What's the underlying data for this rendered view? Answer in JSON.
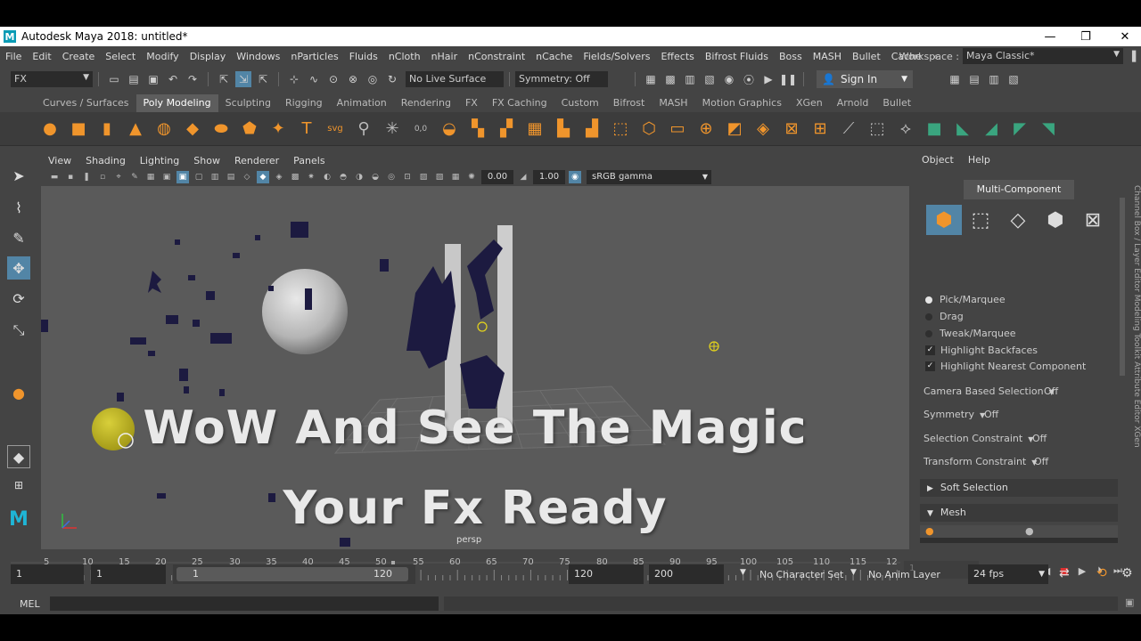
{
  "window": {
    "title": "Autodesk Maya 2018: untitled*",
    "logo": "M",
    "minimize": "—",
    "maximize": "❐",
    "close": "✕"
  },
  "menu": [
    "File",
    "Edit",
    "Create",
    "Select",
    "Modify",
    "Display",
    "Windows",
    "nParticles",
    "Fluids",
    "nCloth",
    "nHair",
    "nConstraint",
    "nCache",
    "Fields/Solvers",
    "Effects",
    "Bifrost Fluids",
    "Boss",
    "MASH",
    "Bullet",
    "Cache"
  ],
  "menu_more": "»",
  "workspace": {
    "label": "Workspace :",
    "value": "Maya Classic*"
  },
  "status": {
    "mode": "FX",
    "live_surface": "No Live Surface",
    "symmetry": "Symmetry: Off",
    "sign_in": "Sign In"
  },
  "shelf_tabs": [
    "Curves / Surfaces",
    "Poly Modeling",
    "Sculpting",
    "Rigging",
    "Animation",
    "Rendering",
    "FX",
    "FX Caching",
    "Custom",
    "Bifrost",
    "MASH",
    "Motion Graphics",
    "XGen",
    "Arnold",
    "Bullet"
  ],
  "shelf_active": "Poly Modeling",
  "viewport_menu": [
    "View",
    "Shading",
    "Lighting",
    "Show",
    "Renderer",
    "Panels"
  ],
  "viewport_fields": {
    "exposure": "0.00",
    "gamma": "1.00",
    "colorspace": "sRGB gamma"
  },
  "viewport_label": "persp",
  "overlay": {
    "line1": "WoW And See The Magic",
    "line2": "Your Fx Ready"
  },
  "panel": {
    "menu": [
      "Object",
      "Help"
    ],
    "mode": "Multi-Component",
    "pick_options": [
      "Pick/Marquee",
      "Drag",
      "Tweak/Marquee"
    ],
    "checks": [
      "Highlight Backfaces",
      "Highlight Nearest Component"
    ],
    "rows": [
      {
        "label": "Camera Based Selection",
        "value": "Off"
      },
      {
        "label": "Symmetry",
        "value": "Off"
      },
      {
        "label": "Selection Constraint",
        "value": "Off"
      },
      {
        "label": "Transform Constraint",
        "value": "Off"
      }
    ],
    "sections": [
      "Soft Selection",
      "Mesh"
    ],
    "side_tabs": "Channel Box / Layer Editor   Modeling Toolkit   Attribute Editor   XGen"
  },
  "timeline": {
    "ticks": [
      "5",
      "10",
      "15",
      "20",
      "25",
      "30",
      "35",
      "40",
      "45",
      "50",
      "55",
      "60",
      "65",
      "70",
      "75",
      "80",
      "85",
      "90",
      "95",
      "100",
      "105",
      "110",
      "115",
      "12"
    ],
    "current": "52",
    "current_frame_field": "1"
  },
  "range": {
    "start": "1",
    "playback_start": "1",
    "slider_start": "1",
    "slider_end": "120",
    "playback_end": "120",
    "end": "200",
    "character_set": "No Character Set",
    "anim_layer": "No Anim Layer",
    "fps": "24 fps"
  },
  "cmdline": {
    "label": "MEL"
  }
}
